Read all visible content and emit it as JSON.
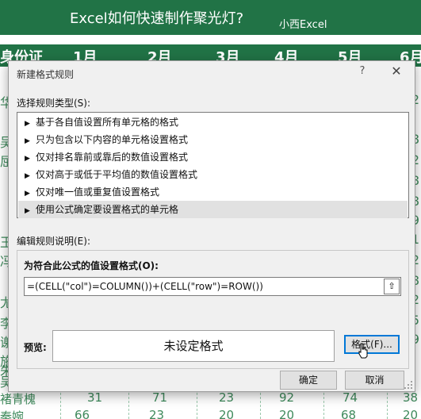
{
  "banner": {
    "title": "Excel如何快速制作聚光灯?",
    "brand": "小西Excel"
  },
  "sheet": {
    "headers": [
      "身份证",
      "1月",
      "2月",
      "3月",
      "4月",
      "5月",
      "6月"
    ],
    "left_chars": [
      "华",
      "吴",
      "屈",
      "王",
      "冯",
      "尤",
      "李",
      "谢",
      "施",
      "朱",
      "吴"
    ],
    "right_digits": [
      "2",
      "8",
      "2",
      "8",
      "8",
      "9",
      "1",
      "2",
      "8",
      "2",
      "5",
      "9"
    ],
    "bottom_rows": [
      [
        "褚青槐",
        "31",
        "71",
        "23",
        "92",
        "74",
        "38"
      ],
      [
        "秦婉",
        "66",
        "23",
        "20",
        "20",
        "68",
        "20"
      ]
    ]
  },
  "dialog": {
    "title": "新建格式规则",
    "help": "?",
    "close": "✕",
    "select_rule_label": "选择规则类型(S):",
    "rules": [
      "基于各自值设置所有单元格的格式",
      "只为包含以下内容的单元格设置格式",
      "仅对排名靠前或靠后的数值设置格式",
      "仅对高于或低于平均值的数值设置格式",
      "仅对唯一值或重复值设置格式",
      "使用公式确定要设置格式的单元格"
    ],
    "selected_rule": 5,
    "edit_label": "编辑规则说明(E):",
    "formula_label": "为符合此公式的值设置格式(O):",
    "formula_value": "=(CELL(\"col\")=COLUMN())+(CELL(\"row\")=ROW())",
    "collapse_icon": "⇧",
    "preview_label": "预览:",
    "preview_text": "未设定格式",
    "format_button": "格式(F)...",
    "ok_button": "确定",
    "cancel_button": "取消"
  },
  "colors": {
    "accent_green": "#217346",
    "focus_blue": "#0078d7"
  }
}
